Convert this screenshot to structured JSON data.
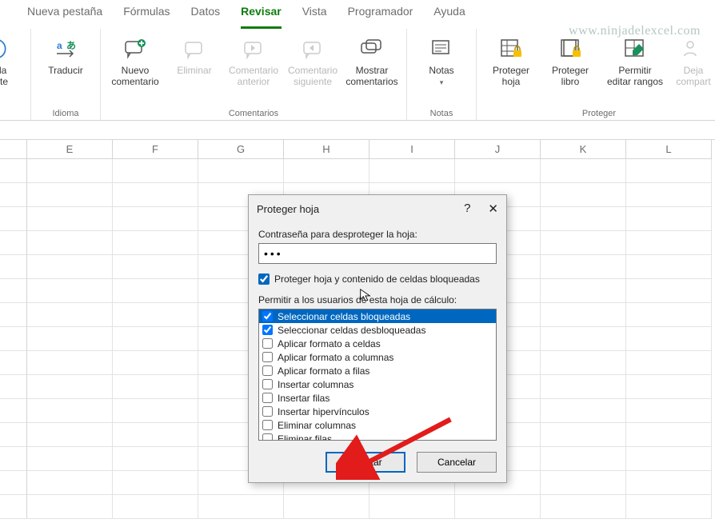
{
  "ribbon": {
    "tabs": [
      "Nueva pestaña",
      "Fórmulas",
      "Datos",
      "Revisar",
      "Vista",
      "Programador",
      "Ayuda"
    ],
    "activeTab": "Revisar",
    "watermark": "www.ninjadelexcel.com",
    "groups": {
      "busqueda": {
        "label": "",
        "btn0": "ueda\ngente"
      },
      "idioma": {
        "label": "Idioma",
        "btn0": "Traducir"
      },
      "comentarios": {
        "label": "Comentarios",
        "btn0": "Nuevo\ncomentario",
        "btn1": "Eliminar",
        "btn2": "Comentario\nanterior",
        "btn3": "Comentario\nsiguiente",
        "btn4": "Mostrar\ncomentarios"
      },
      "notas": {
        "label": "Notas",
        "btn0": "Notas"
      },
      "proteger": {
        "label": "Proteger",
        "btn0": "Proteger\nhoja",
        "btn1": "Proteger\nlibro",
        "btn2": "Permitir\neditar rangos",
        "btn3": "Deja\ncompart"
      }
    }
  },
  "columns": [
    "E",
    "F",
    "G",
    "H",
    "I",
    "J",
    "K",
    "L"
  ],
  "dialog": {
    "title": "Proteger hoja",
    "help": "?",
    "passwordLabel": "Contraseña para desproteger la hoja:",
    "passwordValue": "•••",
    "protectCheck": "Proteger hoja y contenido de celdas bloqueadas",
    "permitLabel": "Permitir a los usuarios de esta hoja de cálculo:",
    "options": [
      {
        "label": "Seleccionar celdas bloqueadas",
        "checked": true,
        "selected": true
      },
      {
        "label": "Seleccionar celdas desbloqueadas",
        "checked": true,
        "selected": false
      },
      {
        "label": "Aplicar formato a celdas",
        "checked": false,
        "selected": false
      },
      {
        "label": "Aplicar formato a columnas",
        "checked": false,
        "selected": false
      },
      {
        "label": "Aplicar formato a filas",
        "checked": false,
        "selected": false
      },
      {
        "label": "Insertar columnas",
        "checked": false,
        "selected": false
      },
      {
        "label": "Insertar filas",
        "checked": false,
        "selected": false
      },
      {
        "label": "Insertar hipervínculos",
        "checked": false,
        "selected": false
      },
      {
        "label": "Eliminar columnas",
        "checked": false,
        "selected": false
      },
      {
        "label": "Eliminar filas",
        "checked": false,
        "selected": false
      }
    ],
    "acceptLabel": "Aceptar",
    "cancelLabel": "Cancelar"
  }
}
